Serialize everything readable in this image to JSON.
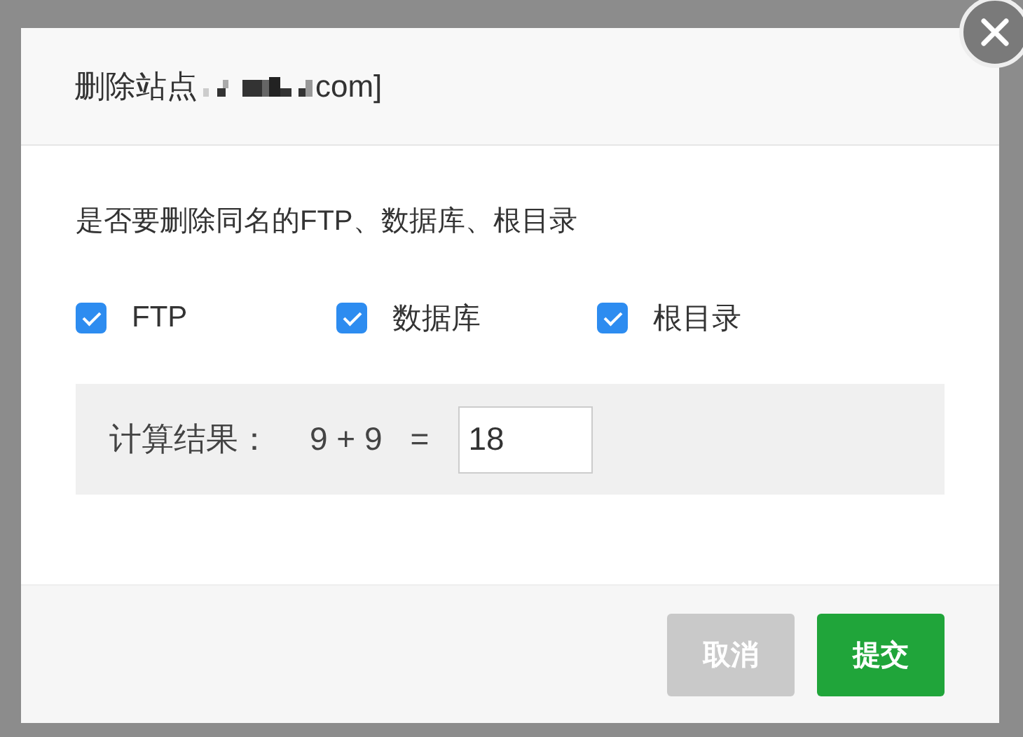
{
  "dialog": {
    "title_prefix": "删除站点",
    "title_suffix": "com]",
    "question": "是否要删除同名的FTP、数据库、根目录",
    "options": [
      {
        "label": "FTP",
        "checked": true
      },
      {
        "label": "数据库",
        "checked": true
      },
      {
        "label": "根目录",
        "checked": true
      }
    ],
    "captcha": {
      "label": "计算结果：",
      "expression": "9 + 9",
      "equals": "=",
      "value": "18"
    },
    "buttons": [
      {
        "label": "取消",
        "kind": "cancel"
      },
      {
        "label": "提交",
        "kind": "submit"
      }
    ]
  }
}
